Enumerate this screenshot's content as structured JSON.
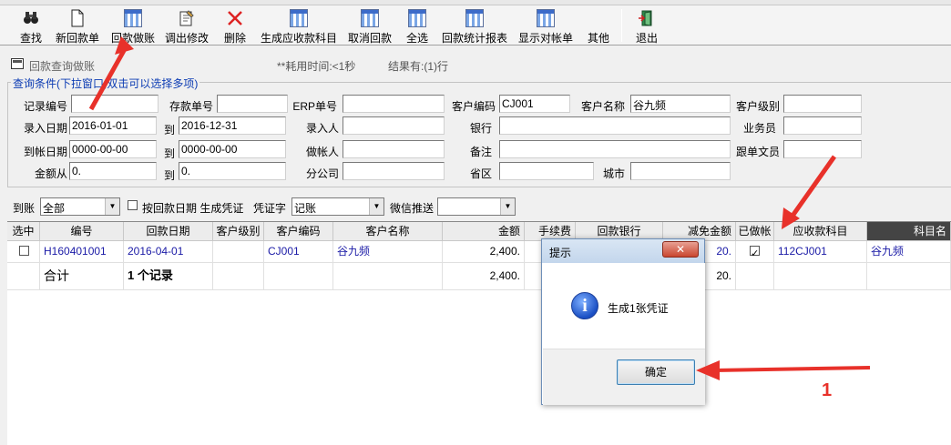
{
  "toolbar": {
    "buttons": [
      {
        "label": "查找",
        "icon": "binoculars-icon"
      },
      {
        "label": "新回款单",
        "icon": "new-document-icon"
      },
      {
        "label": "回款做账",
        "icon": "grid-icon"
      },
      {
        "label": "调出修改",
        "icon": "edit-document-icon"
      },
      {
        "label": "删除",
        "icon": "delete-x-icon"
      },
      {
        "label": "生成应收款科目",
        "icon": "grid-icon"
      },
      {
        "label": "取消回款",
        "icon": "grid-icon"
      },
      {
        "label": "全选",
        "icon": "grid-icon"
      },
      {
        "label": "回款统计报表",
        "icon": "grid-icon"
      },
      {
        "label": "显示对帐单",
        "icon": "grid-icon"
      },
      {
        "label": "其他",
        "icon": ""
      },
      {
        "label": "退出",
        "icon": "exit-door-icon"
      }
    ]
  },
  "panel": {
    "title": "回款查询做账",
    "time": "**耗用时间:<1秒",
    "result": "结果有:(1)行"
  },
  "query": {
    "legend": "查询条件(下拉窗口,双击可以选择多项)",
    "labels": {
      "record_no": "记录编号",
      "deposit_no": "存款单号",
      "erp_no": "ERP单号",
      "customer_code": "客户编码",
      "customer_name": "客户名称",
      "customer_level": "客户级别",
      "entry_date": "录入日期",
      "to1": "到",
      "entered_by": "录入人",
      "bank": "银行",
      "salesperson": "业务员",
      "arrival_date": "到帐日期",
      "to2": "到",
      "booked_by": "做帐人",
      "note": "备注",
      "follow_clerk": "跟单文员",
      "amount_from": "金额从",
      "to3": "到",
      "branch": "分公司",
      "region": "省区",
      "city": "城市"
    },
    "values": {
      "customer_code": "CJ001",
      "customer_name": "谷九频",
      "entry_date_from": "2016-01-01",
      "entry_date_to": "2016-12-31",
      "arrival_date_from": "0000-00-00",
      "arrival_date_to": "0000-00-00",
      "amount_from": "0.",
      "amount_to": "0."
    }
  },
  "filters": {
    "arrival_label": "到账",
    "arrival_value": "全部",
    "voucher_check_label": "按回款日期 生成凭证",
    "voucher_word_label": "凭证字",
    "voucher_word_value": "记账",
    "wechat_label": "微信推送",
    "wechat_value": ""
  },
  "table": {
    "headers": [
      "选中",
      "编号",
      "回款日期",
      "客户级别",
      "客户编码",
      "客户名称",
      "金额",
      "手续费",
      "回款银行",
      "减免金额",
      "已做帐",
      "应收款科目",
      "科目名"
    ],
    "rows": [
      {
        "id": "H160401001",
        "date": "2016-04-01",
        "level": "",
        "code": "CJ001",
        "name": "谷九频",
        "amount": "2,400.",
        "fee": "",
        "bank": "",
        "discount": "20.",
        "booked": true,
        "account": "112CJ001",
        "account_name": "谷九频"
      }
    ],
    "total": {
      "label": "合计",
      "count": "1 个记录",
      "amount": "2,400.",
      "discount": "20."
    }
  },
  "dialog": {
    "title": "提示",
    "close": "✕",
    "message": "生成1张凭证",
    "ok": "确定"
  },
  "annotation": {
    "label": "1"
  }
}
